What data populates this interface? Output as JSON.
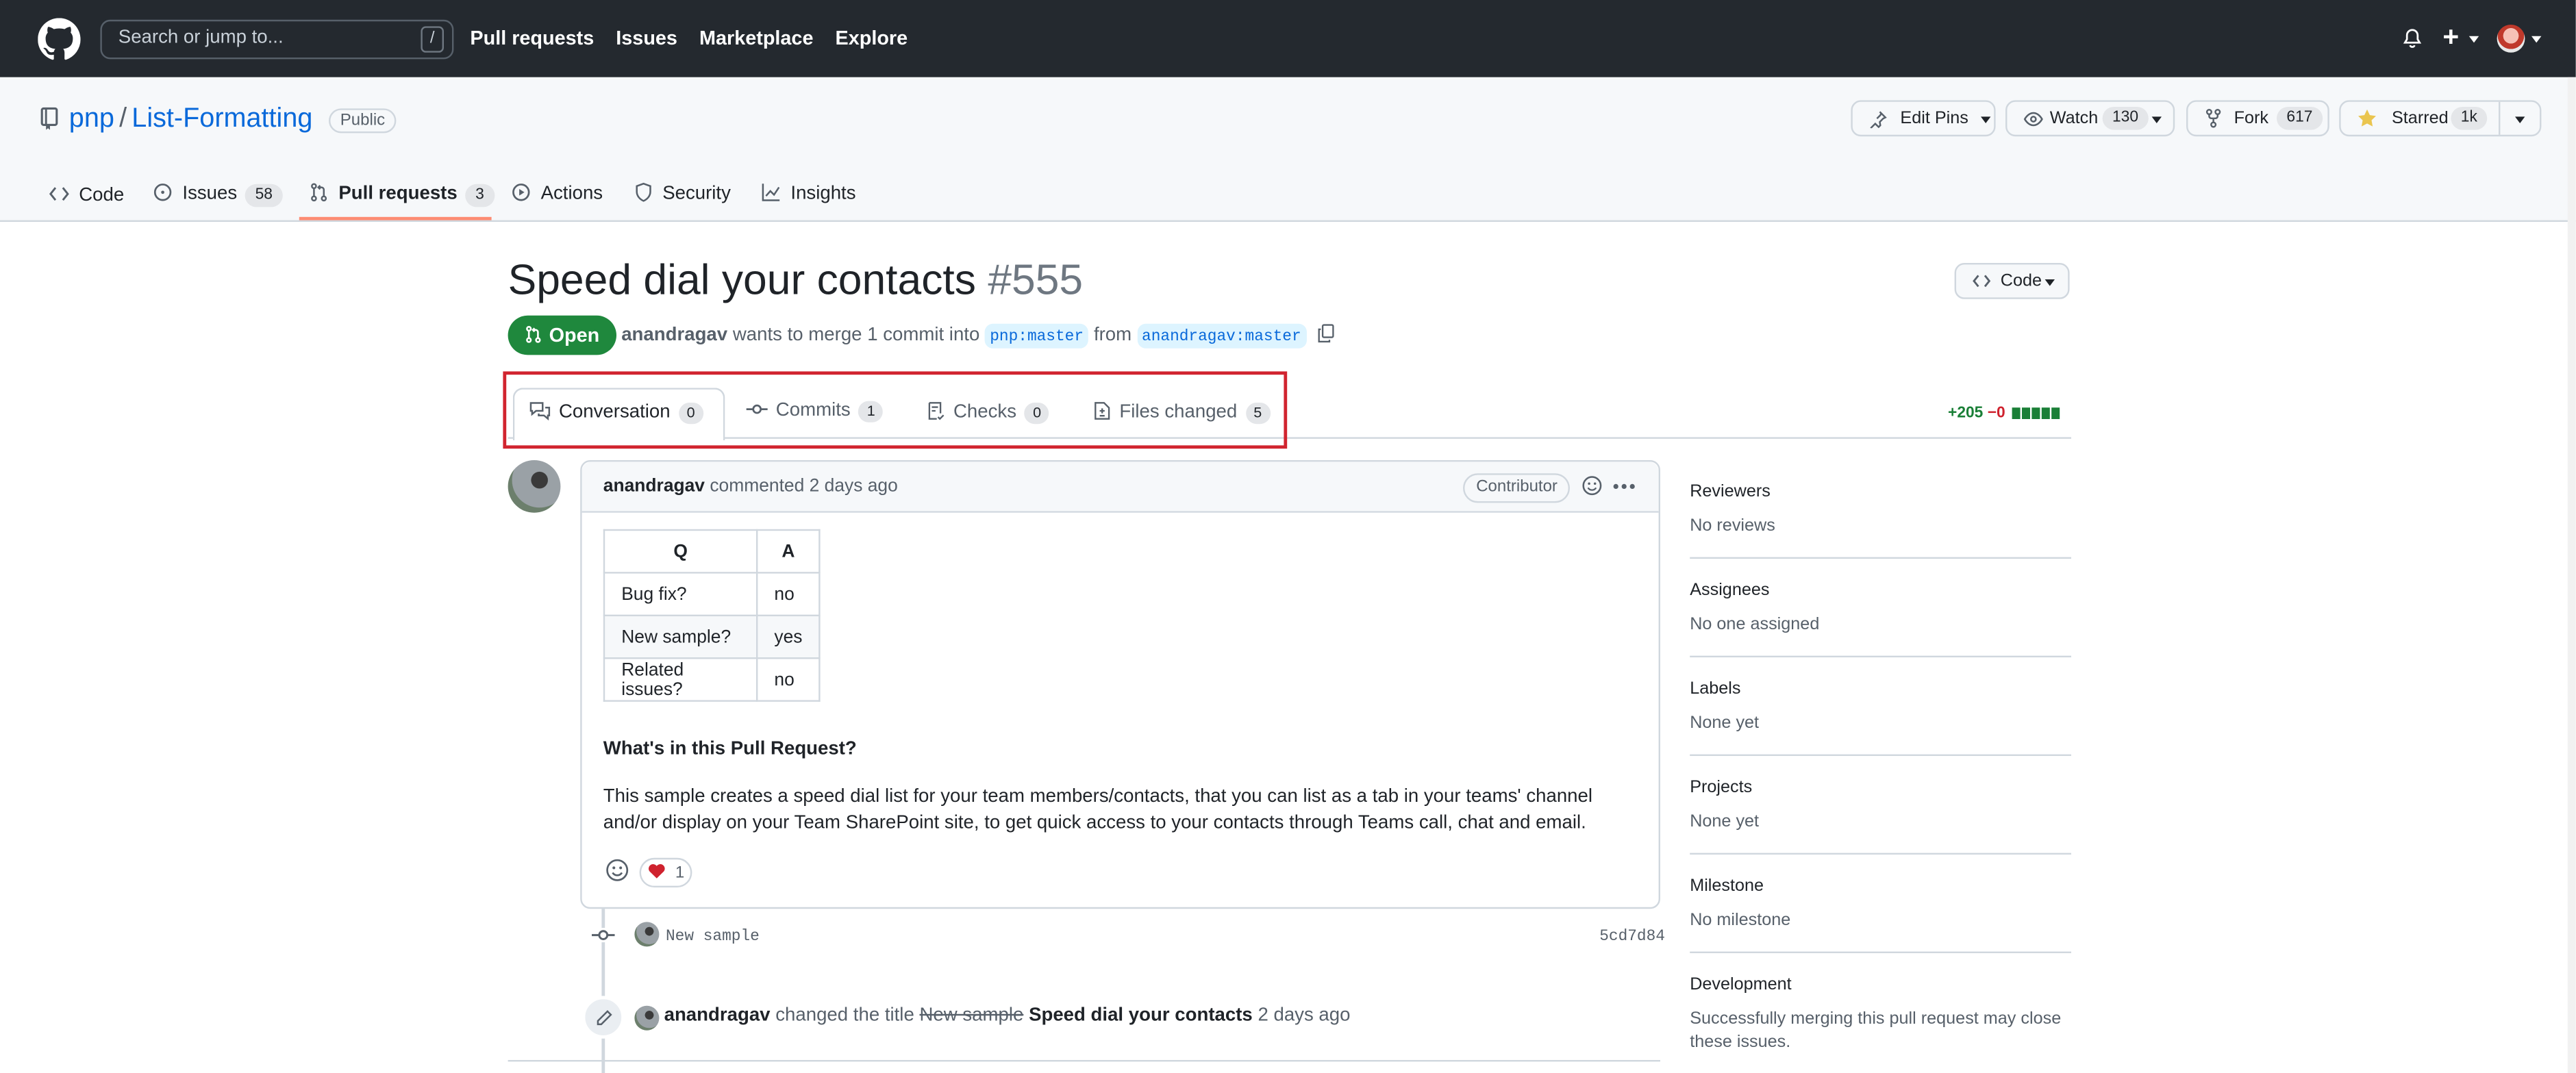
{
  "header": {
    "search_placeholder": "Search or jump to...",
    "search_shortcut": "/",
    "nav": [
      "Pull requests",
      "Issues",
      "Marketplace",
      "Explore"
    ]
  },
  "repo": {
    "owner": "pnp",
    "name": "List-Formatting",
    "visibility": "Public",
    "edit_pins": "Edit Pins",
    "watch_label": "Watch",
    "watch_count": "130",
    "fork_label": "Fork",
    "fork_count": "617",
    "star_label": "Starred",
    "star_count": "1k",
    "tabs": [
      {
        "label": "Code",
        "count": ""
      },
      {
        "label": "Issues",
        "count": "58"
      },
      {
        "label": "Pull requests",
        "count": "3"
      },
      {
        "label": "Actions",
        "count": ""
      },
      {
        "label": "Security",
        "count": ""
      },
      {
        "label": "Insights",
        "count": ""
      }
    ]
  },
  "pr": {
    "title": "Speed dial your contacts",
    "number": "#555",
    "state": "Open",
    "author": "anandragav",
    "meta_mid": "wants to merge 1 commit into",
    "base": "pnp:master",
    "meta_from": "from",
    "head": "anandragav:master",
    "code_button": "Code",
    "tabs": [
      {
        "label": "Conversation",
        "count": "0"
      },
      {
        "label": "Commits",
        "count": "1"
      },
      {
        "label": "Checks",
        "count": "0"
      },
      {
        "label": "Files changed",
        "count": "5"
      }
    ],
    "additions": "+205",
    "deletions": "−0"
  },
  "comment": {
    "author": "anandragav",
    "action": "commented 2 days ago",
    "role": "Contributor",
    "table": {
      "headers": [
        "Q",
        "A"
      ],
      "rows": [
        [
          "Bug fix?",
          "no"
        ],
        [
          "New sample?",
          "yes"
        ],
        [
          "Related issues?",
          "no"
        ]
      ]
    },
    "heading": "What's in this Pull Request?",
    "body": "This sample creates a speed dial list for your team members/contacts, that you can list as a tab in your teams' channel and/or display on your Team SharePoint site, to get quick access to your contacts through Teams call, chat and email.",
    "reaction_count": "1"
  },
  "timeline": {
    "commit_message": "New sample",
    "commit_sha": "5cd7d84",
    "rename_actor": "anandragav",
    "rename_action": "changed the title",
    "old_title": "New sample",
    "new_title": "Speed dial your contacts",
    "rename_time": "2 days ago"
  },
  "sidebar": [
    {
      "heading": "Reviewers",
      "value": "No reviews"
    },
    {
      "heading": "Assignees",
      "value": "No one assigned"
    },
    {
      "heading": "Labels",
      "value": "None yet"
    },
    {
      "heading": "Projects",
      "value": "None yet"
    },
    {
      "heading": "Milestone",
      "value": "No milestone"
    },
    {
      "heading": "Development",
      "value": "Successfully merging this pull request may close these issues."
    }
  ],
  "colors": {
    "header_bg": "#24292f",
    "accent_link": "#0969da",
    "open_green": "#1f883d",
    "highlight_box": "#d1242f",
    "tab_underline": "#fd8c73"
  }
}
